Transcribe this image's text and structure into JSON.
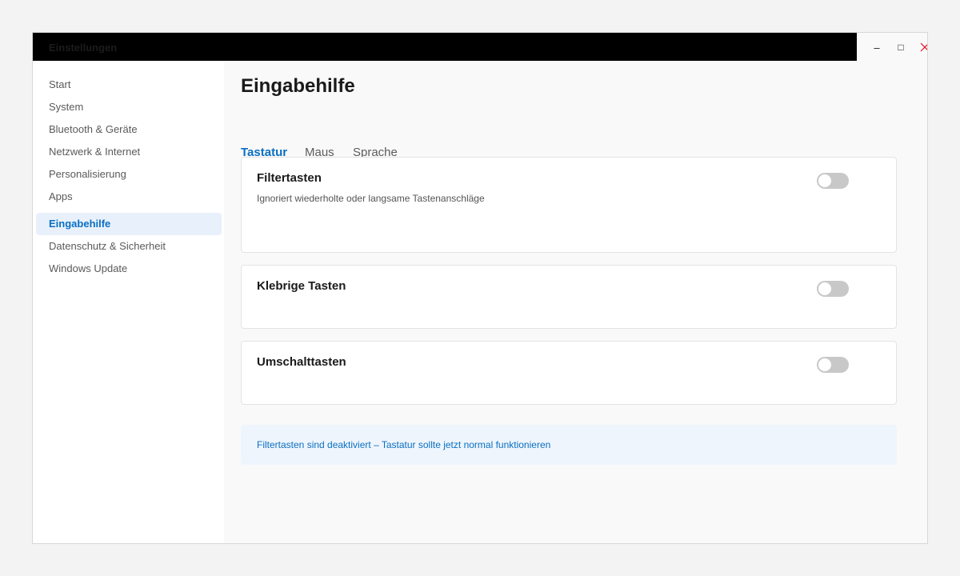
{
  "window": {
    "title": "Einstellungen",
    "controls": {
      "minimize": "–",
      "maximize": "□",
      "close_icon": "close-icon"
    },
    "close_color": "#e81123"
  },
  "sidebar": {
    "items": [
      {
        "label": "Start",
        "active": false
      },
      {
        "label": "System",
        "active": false
      },
      {
        "label": "Bluetooth & Geräte",
        "active": false
      },
      {
        "label": "Netzwerk & Internet",
        "active": false
      },
      {
        "label": "Personalisierung",
        "active": false
      },
      {
        "label": "Apps",
        "active": false
      },
      {
        "label": "Eingabehilfe",
        "active": true
      },
      {
        "label": "Datenschutz & Sicherheit",
        "active": false
      },
      {
        "label": "Windows Update",
        "active": false
      }
    ]
  },
  "main": {
    "title": "Eingabehilfe",
    "tabs": [
      {
        "label": "Tastatur",
        "active": true
      },
      {
        "label": "Maus",
        "active": false
      },
      {
        "label": "Sprache",
        "active": false
      }
    ],
    "cards": [
      {
        "title": "Filtertasten",
        "description": "Ignoriert wiederholte oder langsame Tastenanschläge",
        "enabled": false
      },
      {
        "title": "Klebrige Tasten",
        "enabled": false
      },
      {
        "title": "Umschalttasten",
        "enabled": false
      }
    ],
    "info": "Filtertasten sind deaktiviert – Tastatur sollte jetzt normal funktionieren"
  },
  "colors": {
    "accent": "#0a6fc2",
    "active_nav_bg": "#e8f1fb",
    "info_bg": "#eef5fc",
    "toggle_off": "#c8c8c8"
  }
}
